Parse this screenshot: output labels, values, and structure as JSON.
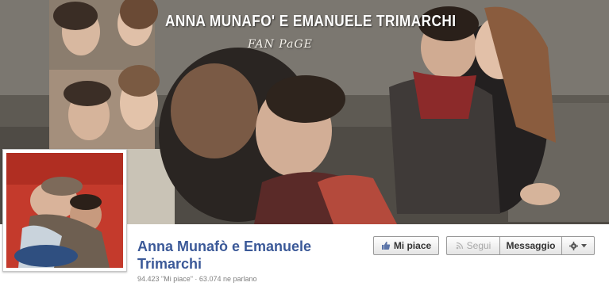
{
  "cover": {
    "title": "ANNA MUNAFO' E EMANUELE TRIMARCHI",
    "subtitle": "FAN PaGE"
  },
  "page": {
    "name": "Anna Munafò e Emanuele Trimarchi",
    "stats": "94.423 \"Mi piace\" · 63.074 ne parlano"
  },
  "actions": {
    "like_label": "Mi piace",
    "follow_label": "Segui",
    "message_label": "Messaggio"
  },
  "icons": {
    "like": "thumbs-up-icon",
    "follow": "rss-icon",
    "settings": "gear-icon",
    "dropdown": "caret-down-icon"
  },
  "colors": {
    "page_name": "#3b5998",
    "stats": "#7f7f7f",
    "button_border": "#999999"
  }
}
